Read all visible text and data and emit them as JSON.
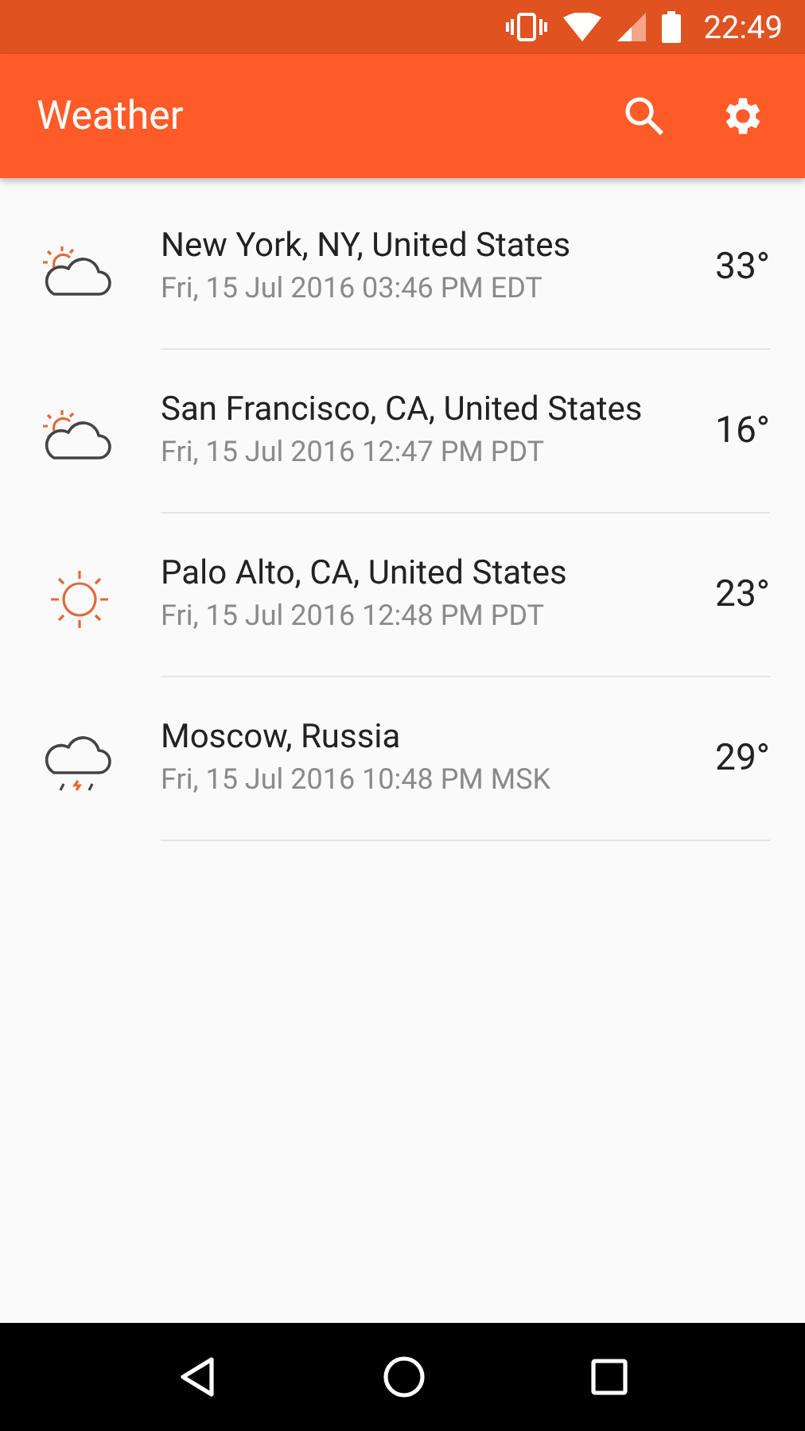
{
  "status_bar": {
    "time": "22:49"
  },
  "app_bar": {
    "title": "Weather"
  },
  "locations": [
    {
      "city": "New York, NY, United States",
      "datetime": "Fri, 15 Jul 2016 03:46 PM EDT",
      "temperature": "33°",
      "kind": "partly_cloudy"
    },
    {
      "city": "San Francisco, CA, United States",
      "datetime": "Fri, 15 Jul 2016 12:47 PM PDT",
      "temperature": "16°",
      "kind": "partly_cloudy"
    },
    {
      "city": "Palo Alto, CA, United States",
      "datetime": "Fri, 15 Jul 2016 12:48 PM PDT",
      "temperature": "23°",
      "kind": "sunny"
    },
    {
      "city": "Moscow, Russia",
      "datetime": "Fri, 15 Jul 2016 10:48 PM MSK",
      "temperature": "29°",
      "kind": "storm"
    }
  ]
}
